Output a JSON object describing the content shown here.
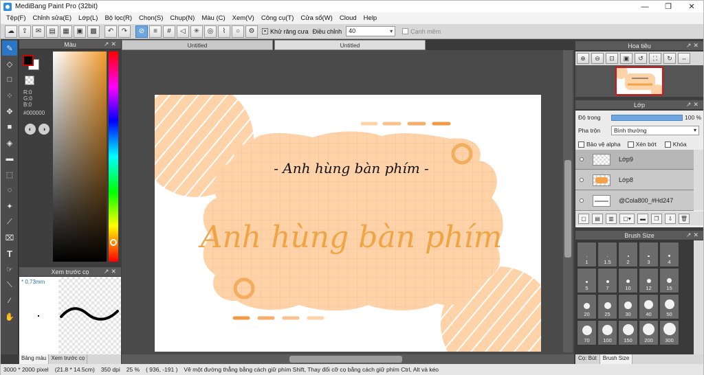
{
  "window": {
    "title": "MediBang Paint Pro (32bit)",
    "controls": [
      "—",
      "❐",
      "✕"
    ]
  },
  "menu": [
    "Tệp(F)",
    "Chỉnh sửa(E)",
    "Lớp(L)",
    "Bộ lọc(R)",
    "Chọn(S)",
    "Chụp(N)",
    "Màu (C)",
    "Xem(V)",
    "Công cụ(T)",
    "Cửa sổ(W)",
    "Cloud",
    "Help"
  ],
  "toolbar": {
    "antialias_label": "Khử răng cưa",
    "antialias_checked": "✕",
    "adjust_label": "Điều chỉnh",
    "adjust_value": "40",
    "edge_label": "Cạnh mềm"
  },
  "color_panel": {
    "title": "Màu",
    "r": "R:0",
    "g": "G:0",
    "b": "B:0",
    "hex": "#000000"
  },
  "preview_panel": {
    "title": "Xem trước cọ",
    "size": "* 0.73mm"
  },
  "left_tabs": [
    "Bảng màu",
    "Xem trước cọ"
  ],
  "doc_tabs": [
    "Untitled",
    "Untitled"
  ],
  "canvas": {
    "small_text": "- Anh hùng bàn phím -",
    "large_text": "Anh hùng bàn phím"
  },
  "navigator": {
    "title": "Hoa tiêu"
  },
  "layer_panel": {
    "title": "Lớp",
    "opacity_label": "Độ trong",
    "opacity_value": "100 %",
    "opacity_fraction": 1.0,
    "blend_label": "Pha trộn",
    "blend_value": "Bình thường",
    "protect_alpha": "Bảo vệ alpha",
    "clipping": "Xén bớt",
    "lock": "Khóa",
    "layers": [
      {
        "name": "Lớp9",
        "thumb": "transparent"
      },
      {
        "name": "Lớp8",
        "thumb": "orange"
      },
      {
        "name": "@Cola800_#Hd247",
        "thumb": "text"
      }
    ]
  },
  "brush_size": {
    "title": "Brush Size",
    "sizes": [
      "1",
      "1.5",
      "2",
      "3",
      "4",
      "5",
      "7",
      "10",
      "12",
      "15",
      "20",
      "25",
      "30",
      "40",
      "50",
      "70",
      "100",
      "150",
      "200",
      "300"
    ]
  },
  "right_tabs": [
    "Cọ: Bút",
    "Brush Size"
  ],
  "status": {
    "size": "3000 * 2000 pixel",
    "cm": "(21.8 * 14.5cm)",
    "dpi": "350 dpi",
    "zoom": "25 %",
    "coords": "( 936, -191 )",
    "hint": "Vẽ một đường thẳng bằng cách giữ phím Shift, Thay đổi cỡ cọ bằng cách giữ phím Ctrl, Alt và kéo"
  },
  "colors": {
    "accent": "#2a76c6",
    "peach": "#ffd2a8",
    "orange": "#f0a444"
  }
}
